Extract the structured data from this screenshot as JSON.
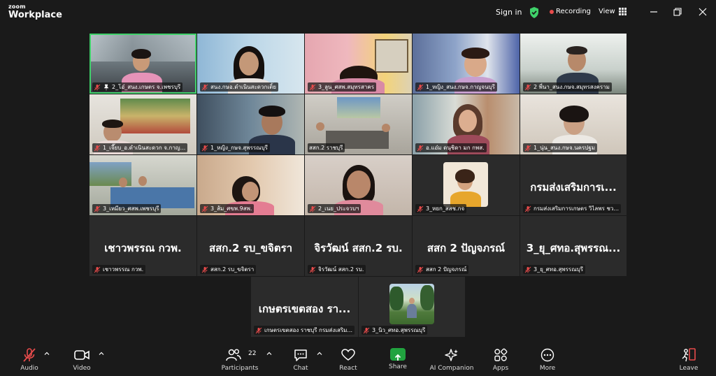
{
  "app": {
    "logo_top": "zoom",
    "logo_bottom": "Workplace"
  },
  "titlebar": {
    "sign_in": "Sign in",
    "recording": "Recording",
    "view": "View"
  },
  "colors": {
    "background": "#1a1a1a",
    "active_speaker": "#3fd16a",
    "recording_dot": "#e74b4b",
    "share": "#21a33f",
    "muted": "#e74b4b"
  },
  "participants": [
    {
      "name": "2_โอ๋_สนง.เกษตร จ.เพชรบุรี",
      "type": "video",
      "active": true,
      "pinned": true
    },
    {
      "name": "สนง.กษอ.ดำเนินสะดวกเติ้ย",
      "type": "video"
    },
    {
      "name": "3_ลูน_ศสพ.สมุทรสาคร",
      "type": "video"
    },
    {
      "name": "1_หญิง_สนง.กษจ.กาญจนบุรี",
      "type": "video"
    },
    {
      "name": "2 พี่นา_สนง.กษจ.สมุทรสงคราม",
      "type": "video"
    },
    {
      "name": "1_เจี๊ยบ_อ.ดำเนินสะดวก จ.กาญ...",
      "type": "video"
    },
    {
      "name": "1_หญิง_กษจ.สุพรรณบุรี",
      "type": "video"
    },
    {
      "name": "สสก.2 ราชบุรี",
      "type": "video"
    },
    {
      "name": "อ.แอ๋ม ดนุชิดา มก กพส.",
      "type": "video"
    },
    {
      "name": "1_นุ่น_สนง.กษจ.นครปฐม",
      "type": "video"
    },
    {
      "name": "3_เหมียว_ศสพ.เพชรบุรี",
      "type": "video"
    },
    {
      "name": "3_ส้ม_ศขพ.9สพ.",
      "type": "video"
    },
    {
      "name": "2_เนย_ประจวบฯ",
      "type": "video"
    },
    {
      "name": "3_หยก_สสช.กจ",
      "type": "photo"
    },
    {
      "name": "กรมส่งเสริมการเกษตร วิไลพร ชว...",
      "type": "text",
      "display": "กรมส่งเสริมการเ..."
    },
    {
      "name": "เชาวพรรณ กวพ.",
      "type": "text",
      "display": "เชาวพรรณ กวพ."
    },
    {
      "name": "สสก.2 รบ_ขจิตรา",
      "type": "text",
      "display": "สสก.2 รบ_ขจิตรา"
    },
    {
      "name": "จิรวัฒน์ สสก.2 รบ.",
      "type": "text",
      "display": "จิรวัฒน์ สสก.2 รบ."
    },
    {
      "name": "สสก 2 ปัญจภรณ์",
      "type": "text",
      "display": "สสก 2 ปัญจภรณ์"
    },
    {
      "name": "3_ยุ_ศทอ.สุพรรณบุรี",
      "type": "text",
      "display": "3_ยุ_ศทอ.สุพรรณ..."
    },
    {
      "name": "เกษตรเขตสอง ราชบุรี กรมส่งเสริม...",
      "type": "text",
      "display": "เกษตรเขตสอง รา..."
    },
    {
      "name": "3_นิว_ศทอ.สุพรรณบุรี",
      "type": "photo"
    }
  ],
  "toolbar": {
    "audio": "Audio",
    "video": "Video",
    "participants": "Participants",
    "participants_count": "22",
    "chat": "Chat",
    "react": "React",
    "share": "Share",
    "ai_companion": "AI Companion",
    "apps": "Apps",
    "more": "More",
    "leave": "Leave"
  },
  "icons": [
    "shield-check-icon",
    "grid-icon",
    "minimize-icon",
    "restore-icon",
    "close-icon",
    "mic-off-icon",
    "camera-icon",
    "people-icon",
    "chat-icon",
    "heart-icon",
    "share-up-icon",
    "sparkle-icon",
    "apps-icon",
    "more-icon",
    "leave-icon",
    "chevron-up-icon"
  ]
}
